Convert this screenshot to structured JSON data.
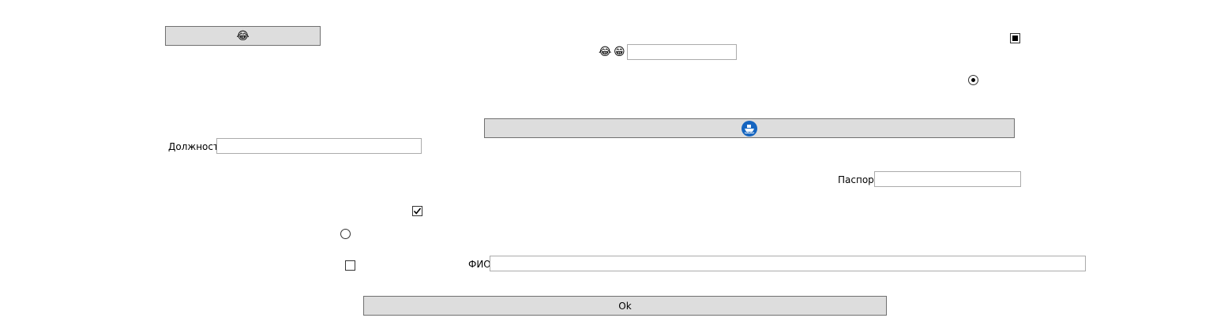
{
  "buttons": {
    "top_left_icon": "laughing-face-icon",
    "wide_middle_icon": "ship-refresh-icon",
    "ok_label": "Ok"
  },
  "emoji_pair": {
    "first_icon": "laughing-face-icon",
    "second_icon": "grinning-face-icon"
  },
  "text_field": {
    "value": ""
  },
  "position_field": {
    "label": "Должность",
    "value": ""
  },
  "passport_field": {
    "label": "Паспорт",
    "value": ""
  },
  "fio_field": {
    "label": "ФИО",
    "value": ""
  },
  "checkboxes": {
    "top_right_indeterminate": "indeterminate",
    "middle_checked": "checked",
    "lower_unchecked": "unchecked"
  },
  "radios": {
    "right_selected": "selected",
    "left_unselected": "unselected"
  },
  "colors": {
    "button_bg": "#dddddd",
    "button_border": "#707070",
    "field_border": "#ababab",
    "ship_icon_blue": "#1565c0"
  }
}
